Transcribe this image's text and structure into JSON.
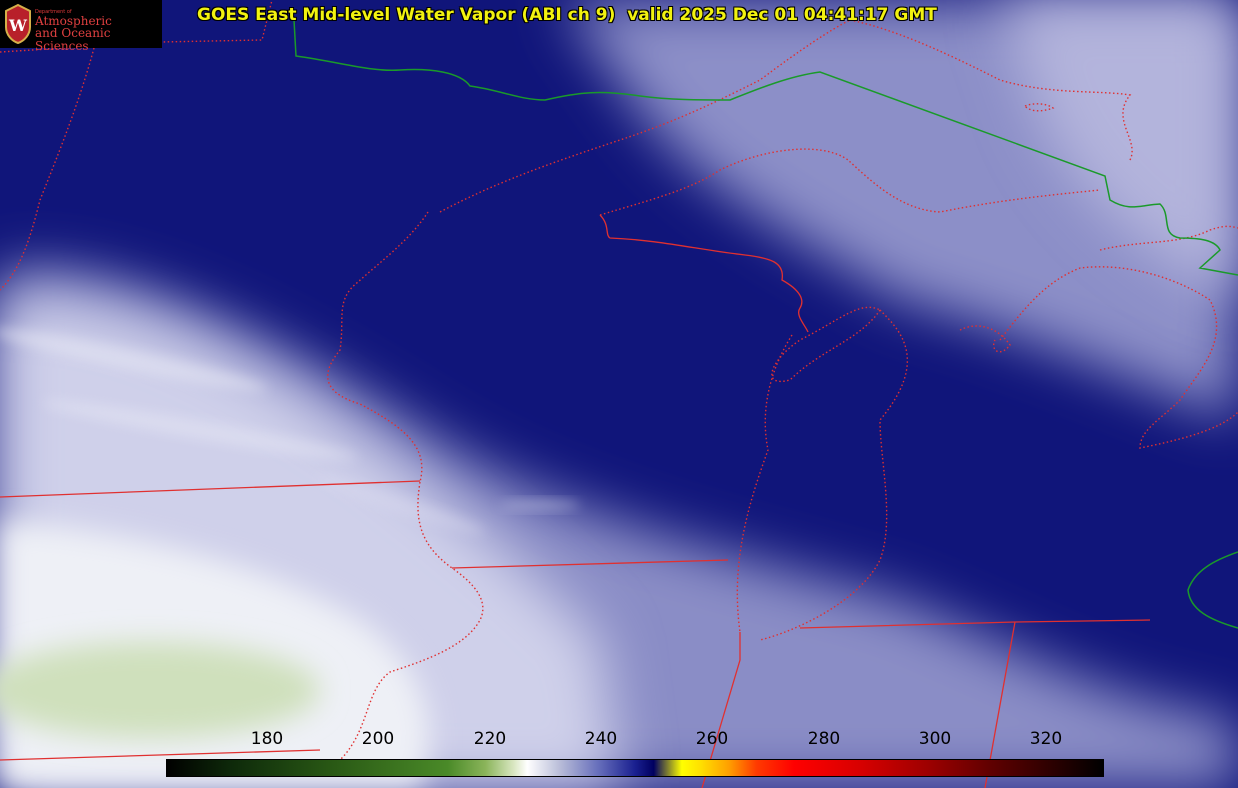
{
  "title": "GOES East Mid-level Water Vapor (ABI ch 9)  valid 2025 Dec 01 04:41:17 GMT",
  "logo": {
    "department_line": "Department of",
    "line1": "Atmospheric",
    "line2": "and Oceanic Sciences",
    "seal_letter": "W"
  },
  "colorbar": {
    "ticks": [
      "180",
      "200",
      "220",
      "240",
      "260",
      "280",
      "300",
      "320"
    ]
  },
  "colors": {
    "border_country": "#1a9a2a",
    "border_state": "#e03030",
    "title_text": "#f2f210",
    "deep_vapor": "#10157a"
  }
}
